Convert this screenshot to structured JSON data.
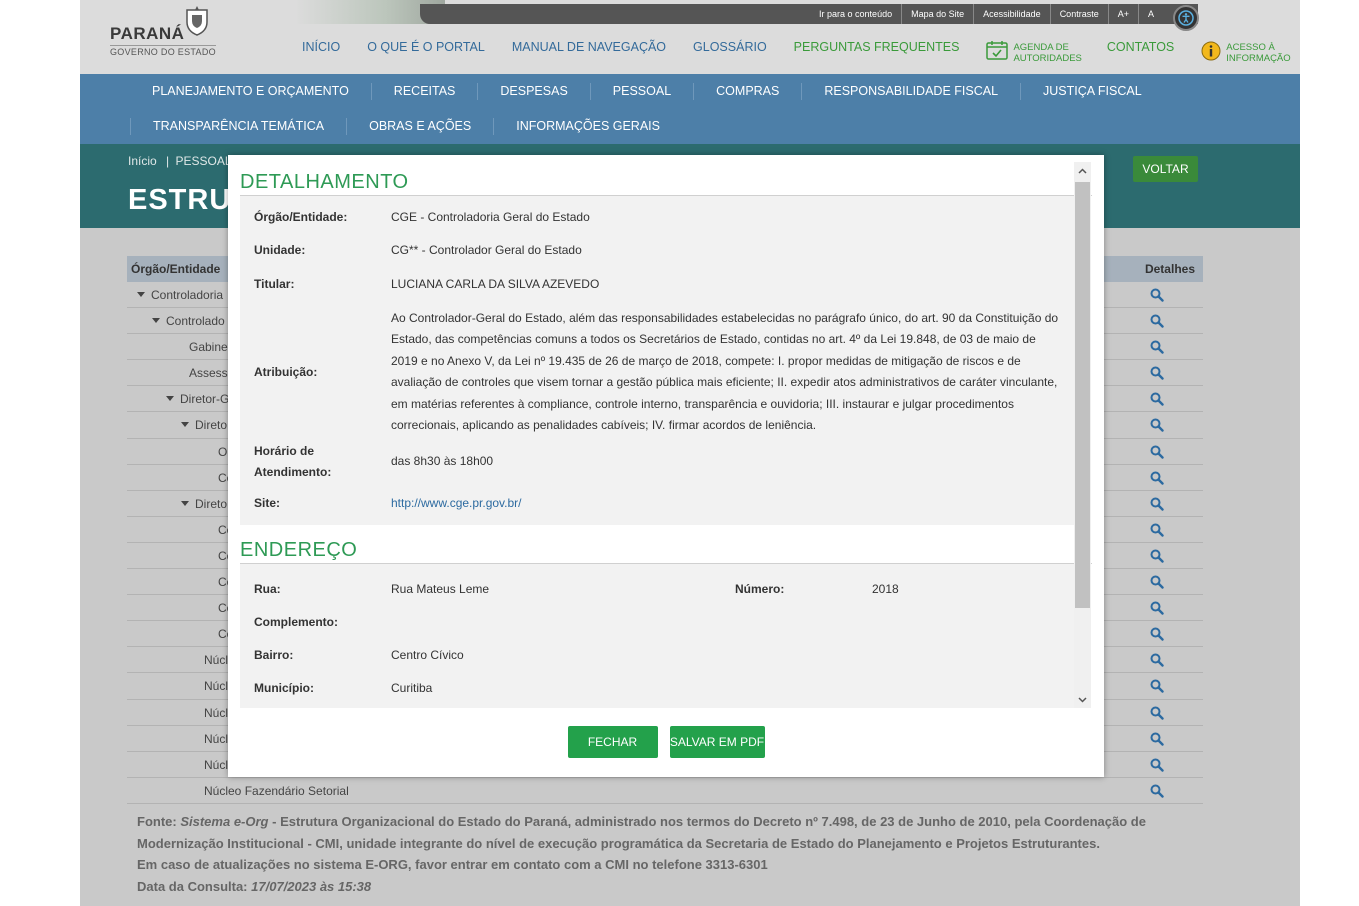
{
  "header": {
    "logo_name": "PARANÁ",
    "logo_sub": "GOVERNO DO ESTADO",
    "utility": [
      "Ir para o conteúdo",
      "Mapa do Site",
      "Acessibilidade",
      "Contraste",
      "A+",
      "A"
    ],
    "nav": [
      "INÍCIO",
      "O QUE É O PORTAL",
      "MANUAL DE NAVEGAÇÃO",
      "GLOSSÁRIO",
      "PERGUNTAS FREQUENTES"
    ],
    "agenda_line1": "AGENDA DE",
    "agenda_line2": "AUTORIDADES",
    "contatos": "CONTATOS",
    "acesso_line1": "ACESSO À",
    "acesso_line2": "INFORMAÇÃO"
  },
  "menu": {
    "row1": [
      "PLANEJAMENTO E ORÇAMENTO",
      "RECEITAS",
      "DESPESAS",
      "PESSOAL",
      "COMPRAS",
      "RESPONSABILIDADE FISCAL",
      "JUSTIÇA FISCAL"
    ],
    "row2": [
      "TRANSPARÊNCIA TEMÁTICA",
      "OBRAS E AÇÕES",
      "INFORMAÇÕES GERAIS"
    ]
  },
  "breadcrumb": {
    "home": "Início",
    "sep": "|",
    "current": "PESSOAL"
  },
  "page_title": "ESTRUT",
  "voltar_label": "VOLTAR",
  "table": {
    "col_orgao": "Órgão/Entidade",
    "col_detalhes": "Detalhes",
    "rows": [
      {
        "text": "Controladoria",
        "indent": 1,
        "caret": true
      },
      {
        "text": "Controlado",
        "indent": 2,
        "caret": true
      },
      {
        "text": "Gabinet",
        "indent": 3,
        "caret": false
      },
      {
        "text": "Assesso",
        "indent": 3,
        "caret": false
      },
      {
        "text": "Diretor-G",
        "indent": 3,
        "caret": true
      },
      {
        "text": "Direto",
        "indent": 4,
        "caret": true
      },
      {
        "text": "Ob",
        "indent": 5,
        "caret": false
      },
      {
        "text": "Co",
        "indent": 5,
        "caret": false
      },
      {
        "text": "Direto",
        "indent": 4,
        "caret": true
      },
      {
        "text": "Co",
        "indent": 5,
        "caret": false
      },
      {
        "text": "Co",
        "indent": 5,
        "caret": false
      },
      {
        "text": "Co",
        "indent": 5,
        "caret": false
      },
      {
        "text": "Co",
        "indent": 5,
        "caret": false
      },
      {
        "text": "Co",
        "indent": 5,
        "caret": false
      },
      {
        "text": "Núcle",
        "indent": 4,
        "caret": false
      },
      {
        "text": "Núcle",
        "indent": 4,
        "caret": false
      },
      {
        "text": "Núcle",
        "indent": 4,
        "caret": false
      },
      {
        "text": "Núcle",
        "indent": 4,
        "caret": false
      },
      {
        "text": "Núcle",
        "indent": 4,
        "caret": false
      },
      {
        "text": "Núcleo Fazendário Setorial",
        "indent": 4,
        "caret": false
      }
    ]
  },
  "footer": {
    "fonte_label": "Fonte:",
    "fonte_system": "Sistema e-Org",
    "fonte_text": "- Estrutura Organizacional do Estado do Paraná, administrado nos termos do Decreto nº 7.498, de 23 de Junho de 2010, pela Coordenação de Modernização Institucional - CMI, unidade integrante do nível de execução programática da Secretaria de Estado do Planejamento e Projetos Estruturantes.",
    "contato_text": "Em caso de atualizações no sistema E-ORG, favor entrar em contato com a CMI no telefone 3313-6301",
    "data_label": "Data da Consulta:",
    "data_value": "17/07/2023 às 15:38"
  },
  "modal": {
    "detalhamento_title": "DETALHAMENTO",
    "orgao_label": "Órgão/Entidade:",
    "orgao_value": "CGE - Controladoria Geral do Estado",
    "unidade_label": "Unidade:",
    "unidade_value": "CG** - Controlador Geral do Estado",
    "titular_label": "Titular:",
    "titular_value": "LUCIANA CARLA DA SILVA AZEVEDO",
    "atribuicao_label": "Atribuição:",
    "atribuicao_value": "Ao Controlador-Geral do Estado, além das responsabilidades estabelecidas no parágrafo único, do art. 90 da Constituição do Estado, das competências comuns a todos os Secretários de Estado, contidas no art. 4º da Lei 19.848, de 03 de maio de 2019 e no Anexo V, da Lei nº 19.435 de 26 de março de 2018, compete: I. propor medidas de mitigação de riscos e de avaliação de controles que visem tornar a gestão pública mais eficiente; II. expedir atos administrativos de caráter vinculante, em matérias referentes à compliance, controle interno, transparência e ouvidoria; III. instaurar e julgar procedimentos correcionais, aplicando as penalidades cabíveis; IV. firmar acordos de leniência.",
    "horario_label_1": "Horário de",
    "horario_label_2": "Atendimento:",
    "horario_value": "das 8h30 às 18h00",
    "site_label": "Site:",
    "site_value": "http://www.cge.pr.gov.br/",
    "endereco_title": "ENDEREÇO",
    "rua_label": "Rua:",
    "rua_value": "Rua Mateus Leme",
    "numero_label": "Número:",
    "numero_value": "2018",
    "complemento_label": "Complemento:",
    "complemento_value": "",
    "bairro_label": "Bairro:",
    "bairro_value": "Centro Cívico",
    "municipio_label": "Município:",
    "municipio_value": "Curitiba",
    "fechar_label": "FECHAR",
    "pdf_label": "SALVAR EM PDF"
  },
  "colors": {
    "green": "#23a14b",
    "blue_menu": "#4d7fa8",
    "teal": "#2c6b6f",
    "link": "#2c6aa0"
  }
}
